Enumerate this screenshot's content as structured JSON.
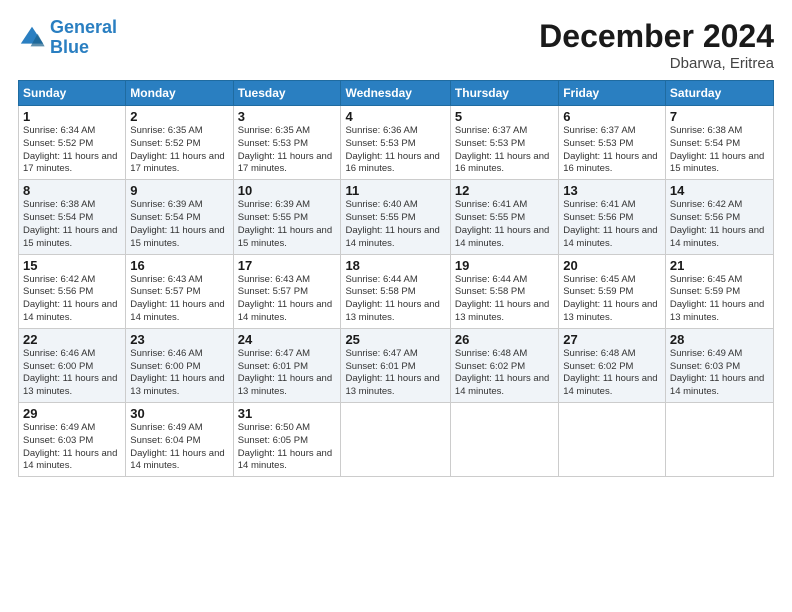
{
  "logo": {
    "line1": "General",
    "line2": "Blue"
  },
  "title": "December 2024",
  "subtitle": "Dbarwa, Eritrea",
  "days_of_week": [
    "Sunday",
    "Monday",
    "Tuesday",
    "Wednesday",
    "Thursday",
    "Friday",
    "Saturday"
  ],
  "weeks": [
    [
      {
        "day": 1,
        "sunrise": "6:34 AM",
        "sunset": "5:52 PM",
        "daylight": "11 hours and 17 minutes."
      },
      {
        "day": 2,
        "sunrise": "6:35 AM",
        "sunset": "5:52 PM",
        "daylight": "11 hours and 17 minutes."
      },
      {
        "day": 3,
        "sunrise": "6:35 AM",
        "sunset": "5:53 PM",
        "daylight": "11 hours and 17 minutes."
      },
      {
        "day": 4,
        "sunrise": "6:36 AM",
        "sunset": "5:53 PM",
        "daylight": "11 hours and 16 minutes."
      },
      {
        "day": 5,
        "sunrise": "6:37 AM",
        "sunset": "5:53 PM",
        "daylight": "11 hours and 16 minutes."
      },
      {
        "day": 6,
        "sunrise": "6:37 AM",
        "sunset": "5:53 PM",
        "daylight": "11 hours and 16 minutes."
      },
      {
        "day": 7,
        "sunrise": "6:38 AM",
        "sunset": "5:54 PM",
        "daylight": "11 hours and 15 minutes."
      }
    ],
    [
      {
        "day": 8,
        "sunrise": "6:38 AM",
        "sunset": "5:54 PM",
        "daylight": "11 hours and 15 minutes."
      },
      {
        "day": 9,
        "sunrise": "6:39 AM",
        "sunset": "5:54 PM",
        "daylight": "11 hours and 15 minutes."
      },
      {
        "day": 10,
        "sunrise": "6:39 AM",
        "sunset": "5:55 PM",
        "daylight": "11 hours and 15 minutes."
      },
      {
        "day": 11,
        "sunrise": "6:40 AM",
        "sunset": "5:55 PM",
        "daylight": "11 hours and 14 minutes."
      },
      {
        "day": 12,
        "sunrise": "6:41 AM",
        "sunset": "5:55 PM",
        "daylight": "11 hours and 14 minutes."
      },
      {
        "day": 13,
        "sunrise": "6:41 AM",
        "sunset": "5:56 PM",
        "daylight": "11 hours and 14 minutes."
      },
      {
        "day": 14,
        "sunrise": "6:42 AM",
        "sunset": "5:56 PM",
        "daylight": "11 hours and 14 minutes."
      }
    ],
    [
      {
        "day": 15,
        "sunrise": "6:42 AM",
        "sunset": "5:56 PM",
        "daylight": "11 hours and 14 minutes."
      },
      {
        "day": 16,
        "sunrise": "6:43 AM",
        "sunset": "5:57 PM",
        "daylight": "11 hours and 14 minutes."
      },
      {
        "day": 17,
        "sunrise": "6:43 AM",
        "sunset": "5:57 PM",
        "daylight": "11 hours and 14 minutes."
      },
      {
        "day": 18,
        "sunrise": "6:44 AM",
        "sunset": "5:58 PM",
        "daylight": "11 hours and 13 minutes."
      },
      {
        "day": 19,
        "sunrise": "6:44 AM",
        "sunset": "5:58 PM",
        "daylight": "11 hours and 13 minutes."
      },
      {
        "day": 20,
        "sunrise": "6:45 AM",
        "sunset": "5:59 PM",
        "daylight": "11 hours and 13 minutes."
      },
      {
        "day": 21,
        "sunrise": "6:45 AM",
        "sunset": "5:59 PM",
        "daylight": "11 hours and 13 minutes."
      }
    ],
    [
      {
        "day": 22,
        "sunrise": "6:46 AM",
        "sunset": "6:00 PM",
        "daylight": "11 hours and 13 minutes."
      },
      {
        "day": 23,
        "sunrise": "6:46 AM",
        "sunset": "6:00 PM",
        "daylight": "11 hours and 13 minutes."
      },
      {
        "day": 24,
        "sunrise": "6:47 AM",
        "sunset": "6:01 PM",
        "daylight": "11 hours and 13 minutes."
      },
      {
        "day": 25,
        "sunrise": "6:47 AM",
        "sunset": "6:01 PM",
        "daylight": "11 hours and 13 minutes."
      },
      {
        "day": 26,
        "sunrise": "6:48 AM",
        "sunset": "6:02 PM",
        "daylight": "11 hours and 14 minutes."
      },
      {
        "day": 27,
        "sunrise": "6:48 AM",
        "sunset": "6:02 PM",
        "daylight": "11 hours and 14 minutes."
      },
      {
        "day": 28,
        "sunrise": "6:49 AM",
        "sunset": "6:03 PM",
        "daylight": "11 hours and 14 minutes."
      }
    ],
    [
      {
        "day": 29,
        "sunrise": "6:49 AM",
        "sunset": "6:03 PM",
        "daylight": "11 hours and 14 minutes."
      },
      {
        "day": 30,
        "sunrise": "6:49 AM",
        "sunset": "6:04 PM",
        "daylight": "11 hours and 14 minutes."
      },
      {
        "day": 31,
        "sunrise": "6:50 AM",
        "sunset": "6:05 PM",
        "daylight": "11 hours and 14 minutes."
      },
      null,
      null,
      null,
      null
    ]
  ]
}
